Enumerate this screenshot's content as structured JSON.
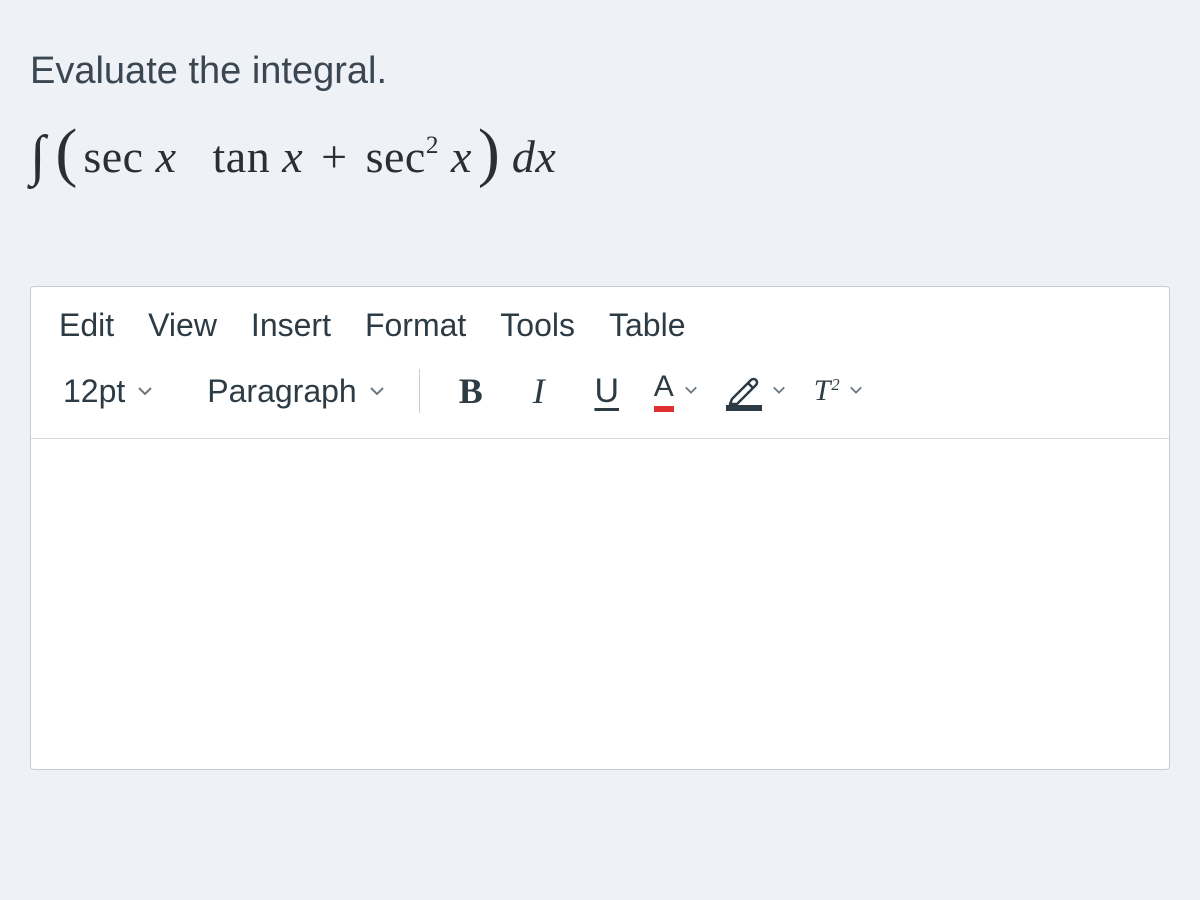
{
  "question": {
    "prompt": "Evaluate the integral.",
    "math_latex": "\\int ( \\sec x \\tan x + \\sec^2 x )\\, dx",
    "math_parts": {
      "integral_sign": "∫",
      "lparen": "(",
      "term1_func1": "sec",
      "term1_var1": "x",
      "term1_func2": "tan",
      "term1_var2": "x",
      "plus": "+",
      "term2_func": "sec",
      "term2_exp": "2",
      "term2_var": "x",
      "rparen": ")",
      "diff_d": "d",
      "diff_var": "x"
    }
  },
  "editor": {
    "menu": {
      "edit": "Edit",
      "view": "View",
      "insert": "Insert",
      "format": "Format",
      "tools": "Tools",
      "table": "Table"
    },
    "toolbar": {
      "font_size": "12pt",
      "paragraph": "Paragraph",
      "bold": "B",
      "italic": "I",
      "underline": "U",
      "text_color_letter": "A",
      "text_color_swatch": "#e03131",
      "highlight_swatch": "#2d3b45",
      "superscript_T": "T",
      "superscript_exp": "2"
    },
    "content": ""
  }
}
